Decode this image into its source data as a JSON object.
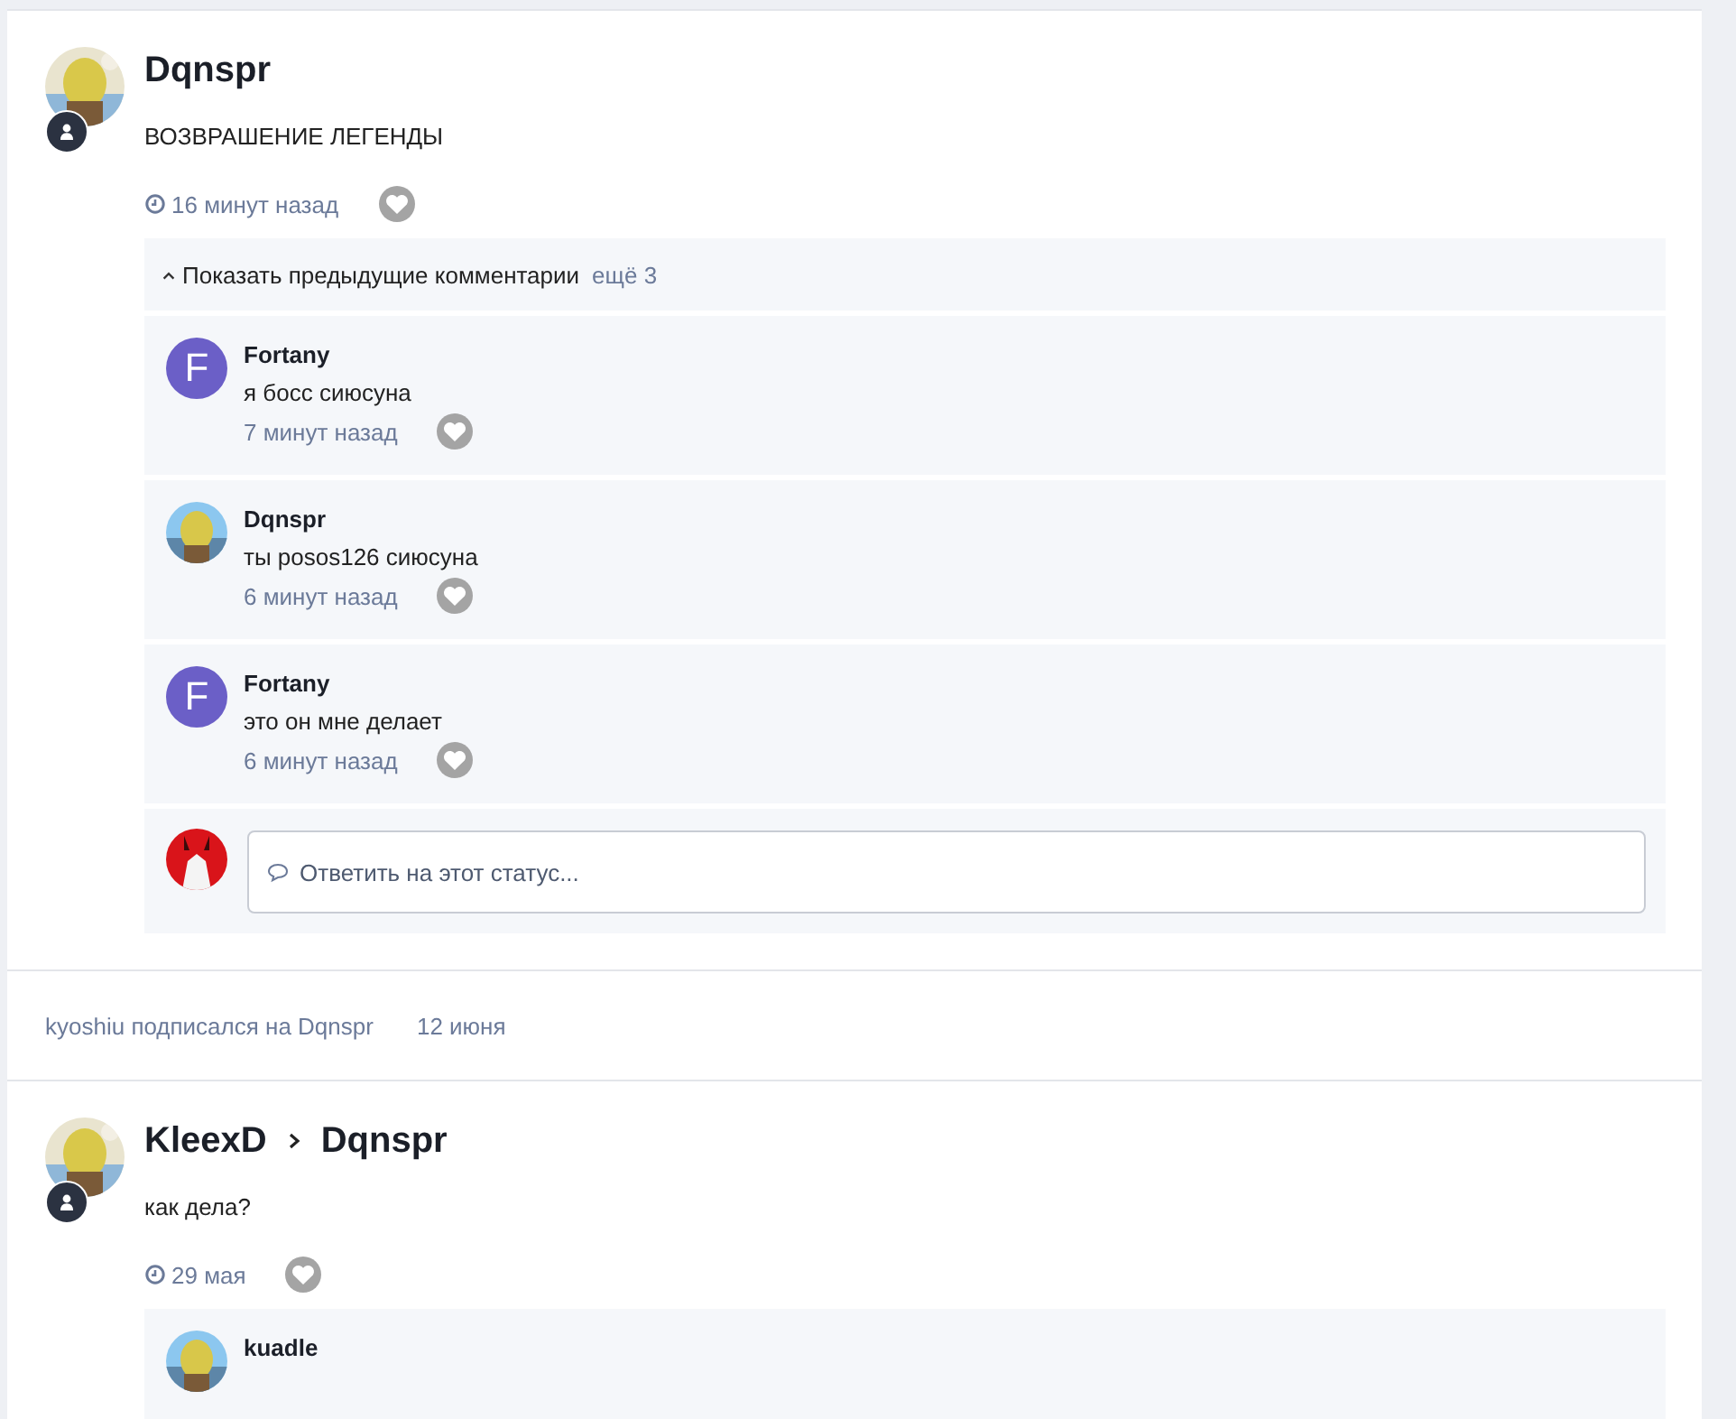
{
  "feed": [
    {
      "kind": "status",
      "author": "Dqnspr",
      "text": "ВОЗВРАШЕНИЕ ЛЕГЕНДЫ",
      "time": "16 минут назад",
      "more": {
        "label": "Показать предыдущие комментарии",
        "count": "ещё 3"
      },
      "comments": [
        {
          "author": "Fortany",
          "avatar": {
            "kind": "letter",
            "letter": "F",
            "color": "#6b5fc7"
          },
          "text": "я босс сиюсуна",
          "time": "7 минут назад"
        },
        {
          "author": "Dqnspr",
          "text": "ты posos126 сиюсуна",
          "time": "6 минут назад"
        },
        {
          "author": "Fortany",
          "avatar": {
            "kind": "letter",
            "letter": "F",
            "color": "#6b5fc7"
          },
          "text": "это он мне делает",
          "time": "6 минут назад"
        }
      ],
      "reply": {
        "placeholder": "Ответить на этот статус..."
      }
    },
    {
      "kind": "activity",
      "text": "kyoshiu подписался на Dqnspr",
      "time": "12 июня"
    },
    {
      "kind": "status",
      "author": "KleexD",
      "target": "Dqnspr",
      "text": "как дела?",
      "time": "29 мая",
      "comments": [
        {
          "author": "kuadle"
        }
      ]
    }
  ]
}
